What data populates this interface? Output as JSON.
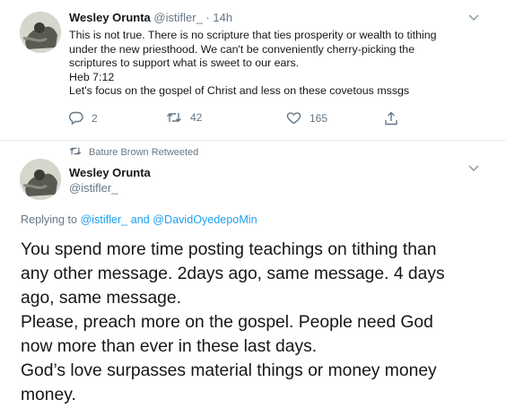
{
  "tweet1": {
    "name": "Wesley Orunta",
    "handle": "@istifler_",
    "dot": "·",
    "time": "14h",
    "caret": "⌄",
    "lines": [
      "This is not true. There is no scripture that ties prosperity or wealth to tithing",
      "under the new priesthood. We can't be conveniently cherry-picking the",
      "scriptures to support what is sweet to our ears.",
      "Heb 7:12",
      "Let's focus on the gospel of Christ and less on these covetous mssgs"
    ],
    "actions": {
      "reply_count": "2",
      "retweet_count": "42",
      "like_count": "165"
    }
  },
  "retweet_notice": "Bature Brown Retweeted",
  "tweet2": {
    "name": "Wesley Orunta",
    "handle": "@istifler_",
    "caret": "⌄",
    "replying_prefix": "Replying to",
    "replying_user1": "@istifler_",
    "replying_and": "and",
    "replying_user2": "@DavidOyedepoMin",
    "lines": [
      "You spend more time posting teachings on tithing than",
      "any other message. 2days ago, same message. 4 days",
      "ago, same message.",
      "Please, preach more on the gospel. People need God",
      "now more than ever in these last days.",
      "God’s love surpasses material things or money money",
      "money."
    ]
  },
  "colors": {
    "text": "#14171a",
    "secondary": "#657786",
    "link": "#1da1f2",
    "divider": "#e6ecf0"
  },
  "icons": [
    "reply-icon",
    "retweet-icon",
    "like-icon",
    "share-icon",
    "caret-down-icon"
  ]
}
